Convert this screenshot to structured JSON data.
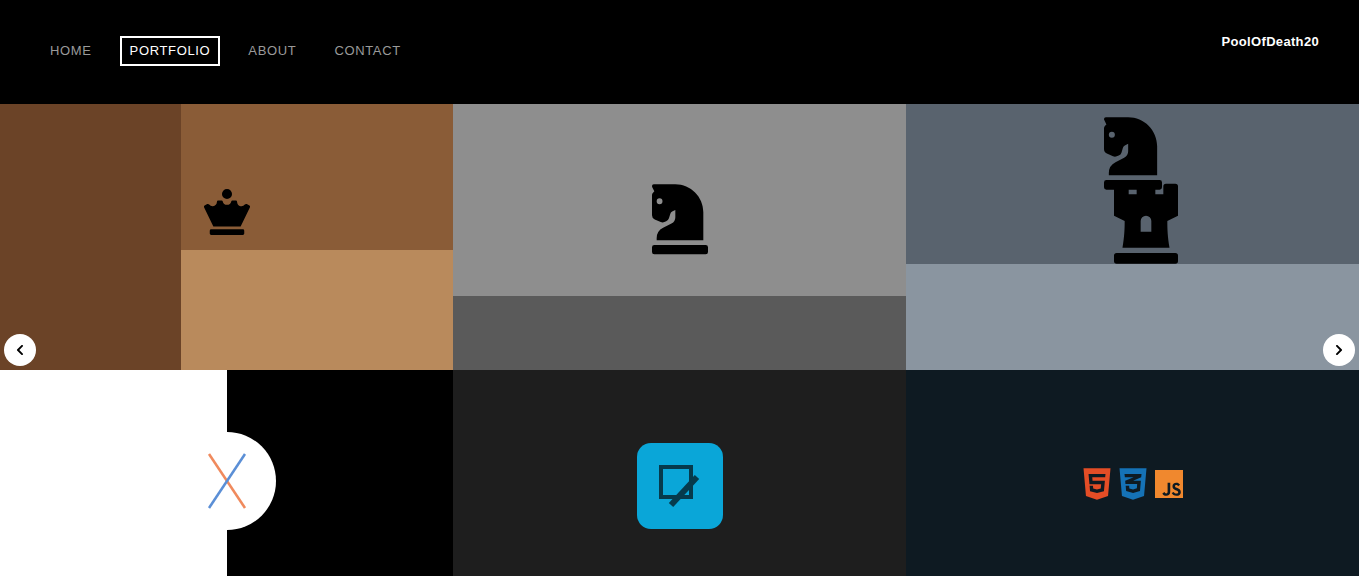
{
  "nav": {
    "items": [
      {
        "label": "HOME",
        "selected": false
      },
      {
        "label": "PORTFOLIO",
        "selected": true
      },
      {
        "label": "ABOUT",
        "selected": false
      },
      {
        "label": "CONTACT",
        "selected": false
      }
    ]
  },
  "brand": "PoolOfDeath20",
  "portfolio": {
    "rows": [
      [
        {
          "kind": "chess-queen"
        },
        {
          "kind": "chess-knight"
        },
        {
          "kind": "chess-knight-rook"
        }
      ],
      [
        {
          "kind": "tic-tac-toe"
        },
        {
          "kind": "text-editor"
        },
        {
          "kind": "web-stack"
        }
      ]
    ]
  }
}
